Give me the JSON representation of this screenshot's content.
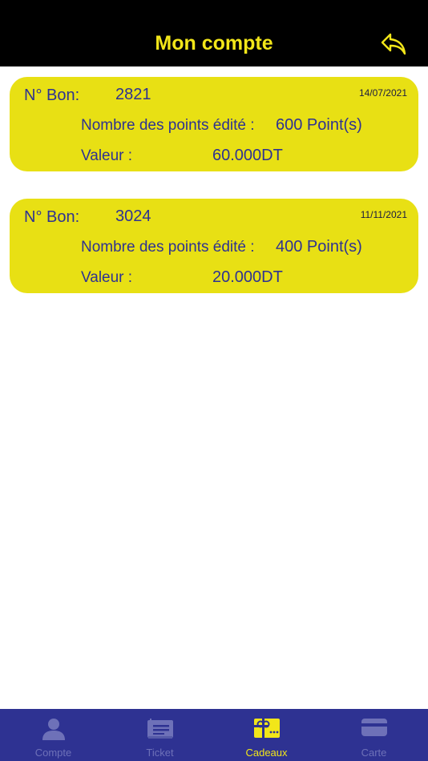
{
  "header": {
    "title": "Mon compte",
    "back_icon": "reply-arrow-icon"
  },
  "colors": {
    "accent": "#f2e619",
    "card": "#e8e014",
    "text": "#2e3292",
    "tabbar": "#2e3292",
    "inactive_tab": "#6e71b8"
  },
  "vouchers": [
    {
      "bon_label": "N° Bon:",
      "bon_number": "2821",
      "date": "14/07/2021",
      "points_label": "Nombre des points édité :",
      "points_value": "600 Point(s)",
      "value_label": "Valeur :",
      "value": "60.000DT"
    },
    {
      "bon_label": "N° Bon:",
      "bon_number": "3024",
      "date": "11/11/2021",
      "points_label": "Nombre des points édité :",
      "points_value": "400 Point(s)",
      "value_label": "Valeur :",
      "value": "20.000DT"
    }
  ],
  "tabs": [
    {
      "label": "Compte",
      "icon": "user-icon",
      "active": false
    },
    {
      "label": "Ticket",
      "icon": "ticket-icon",
      "active": false
    },
    {
      "label": "Cadeaux",
      "icon": "gift-card-icon",
      "active": true
    },
    {
      "label": "Carte",
      "icon": "credit-card-icon",
      "active": false
    }
  ]
}
